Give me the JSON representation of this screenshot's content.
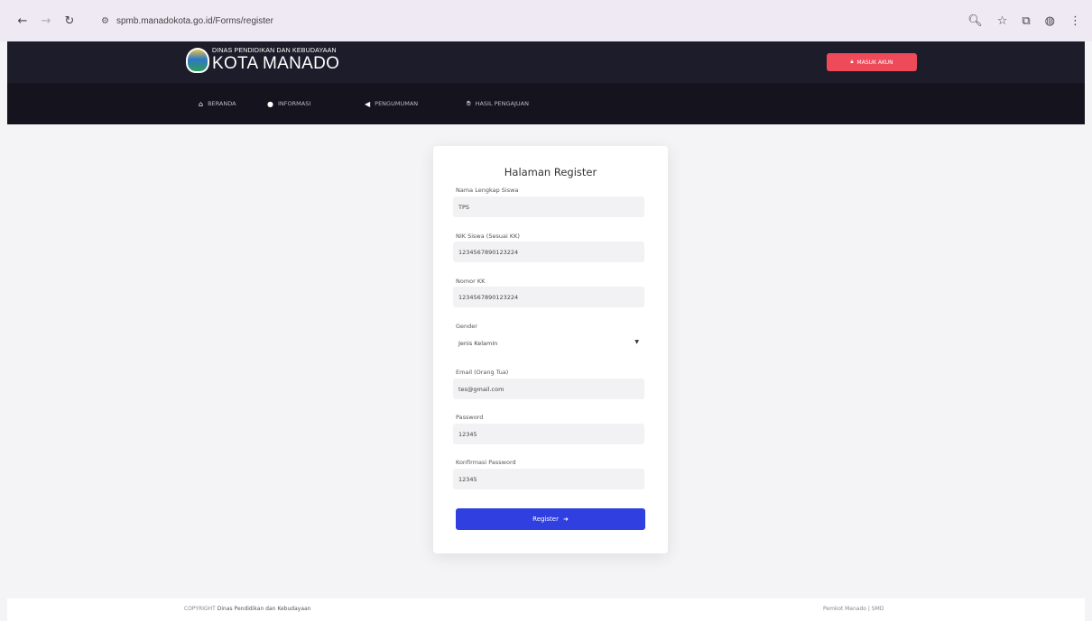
{
  "browser": {
    "url": "spmb.manadokota.go.id/Forms/register",
    "icons": {
      "back": "arrow-left-icon",
      "forward": "arrow-right-icon",
      "reload": "reload-icon",
      "site_info": "tune-icon",
      "zoom": "zoom-icon",
      "bookmark": "star-icon",
      "extensions": "puzzle-icon",
      "profile": "globe-icon",
      "menu": "kebab-menu-icon"
    }
  },
  "header": {
    "logo_small": "DINAS PENDIDIKAN DAN KEBUDAYAAN",
    "logo_big": "KOTA MANADO",
    "login_button": "MASUK AKUN",
    "login_color": "#ee4a5a"
  },
  "nav": {
    "items": [
      {
        "label": "BERANDA",
        "icon": "home-icon"
      },
      {
        "label": "INFORMASI",
        "icon": "info-icon"
      },
      {
        "label": "PENGUMUMAN",
        "icon": "megaphone-icon"
      },
      {
        "label": "HASIL PENGAJUAN",
        "icon": "handshake-icon"
      }
    ]
  },
  "form": {
    "title": "Halaman Register",
    "fields": [
      {
        "label": "Nama Lengkap Siswa",
        "value": "TPS"
      },
      {
        "label": "NIK Siswa (Sesuai KK)",
        "value": "1234567890123224"
      },
      {
        "label": "Nomor KK",
        "value": "1234567890123224"
      },
      {
        "label": "Gender",
        "value": "Jenis Kelamin"
      },
      {
        "label": "Email (Orang Tua)",
        "value": "tes@gmail.com"
      },
      {
        "label": "Password",
        "value": "12345"
      },
      {
        "label": "Konfirmasi Password",
        "value": "12345"
      }
    ],
    "submit_label": "Register",
    "submit_color": "#2f3fe0"
  },
  "footer": {
    "copyright": "COPYRIGHT",
    "org": "Dinas Pendidikan dan Kebudayaan",
    "right": "Pemkot Manado | SMD"
  }
}
